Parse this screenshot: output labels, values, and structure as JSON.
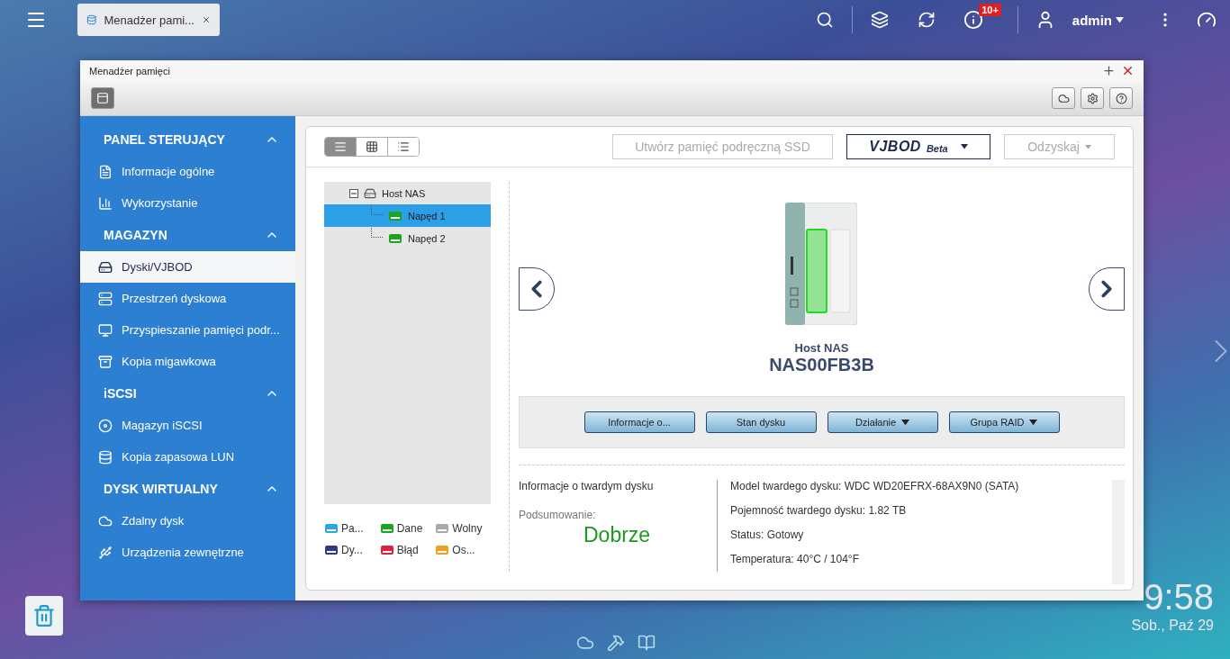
{
  "topbar": {
    "app_tab": "Menadżer pami...",
    "notifications_badge": "10+",
    "user": "admin"
  },
  "window": {
    "title": "Menadżer pamięci"
  },
  "sidebar": [
    {
      "title": "PANEL STERUJĄCY",
      "expanded": true,
      "items": [
        {
          "label": "Informacje ogólne",
          "selected": false
        },
        {
          "label": "Wykorzystanie",
          "selected": false
        }
      ]
    },
    {
      "title": "MAGAZYN",
      "expanded": true,
      "items": [
        {
          "label": "Dyski/VJBOD",
          "selected": true
        },
        {
          "label": "Przestrzeń dyskowa",
          "selected": false
        },
        {
          "label": "Przyspieszanie pamięci podr...",
          "selected": false
        },
        {
          "label": "Kopia migawkowa",
          "selected": false
        }
      ]
    },
    {
      "title": "iSCSI",
      "expanded": true,
      "items": [
        {
          "label": "Magazyn iSCSI",
          "selected": false
        },
        {
          "label": "Kopia zapasowa LUN",
          "selected": false
        }
      ]
    },
    {
      "title": "DYSK WIRTUALNY",
      "expanded": true,
      "items": [
        {
          "label": "Zdalny dysk",
          "selected": false
        },
        {
          "label": "Urządzenia zewnętrzne",
          "selected": false
        }
      ]
    }
  ],
  "toolbar": {
    "views": [
      {
        "selected": true
      },
      {
        "selected": false
      },
      {
        "selected": false
      }
    ],
    "ssd_button": {
      "label": "Utwórz pamięć podręczną SSD",
      "disabled": true
    },
    "vjbod_button": {
      "label": "VJBOD",
      "suffix": "Beta",
      "disabled": false
    },
    "recover_button": {
      "label": "Odzyskaj",
      "disabled": true
    }
  },
  "tree": {
    "label": "Host NAS",
    "expanded": true,
    "children": [
      {
        "label": "Napęd 1",
        "selected": true
      },
      {
        "label": "Napęd 2",
        "selected": false
      }
    ]
  },
  "legend": [
    {
      "label": "Pa...",
      "color": "#29a8e0"
    },
    {
      "label": "Dane",
      "color": "#19a51e"
    },
    {
      "label": "Wolny",
      "color": "#a8a8a8"
    },
    {
      "label": "Dy...",
      "color": "#2b3a8c"
    },
    {
      "label": "Błąd",
      "color": "#e0203c"
    },
    {
      "label": "Os...",
      "color": "#f0a020"
    }
  ],
  "device": {
    "subtitle": "Host NAS",
    "name": "NAS00FB3B",
    "actions": [
      {
        "label": "Informacje o...",
        "dropdown": false
      },
      {
        "label": "Stan dysku",
        "dropdown": false
      },
      {
        "label": "Działanie",
        "dropdown": true
      },
      {
        "label": "Grupa RAID",
        "dropdown": true
      }
    ]
  },
  "info": {
    "heading": "Informacje o twardym dysku",
    "summary_label": "Podsumowanie:",
    "summary_value": "Dobrze",
    "details": [
      "Model twardego dysku: WDC WD20EFRX-68AX9N0 (SATA)",
      "Pojemność twardego dysku: 1.82 TB",
      "Status: Gotowy",
      "Temperatura: 40°C / 104°F"
    ]
  },
  "clock": {
    "time": "9:58",
    "date": "Sob., Paź 29"
  }
}
